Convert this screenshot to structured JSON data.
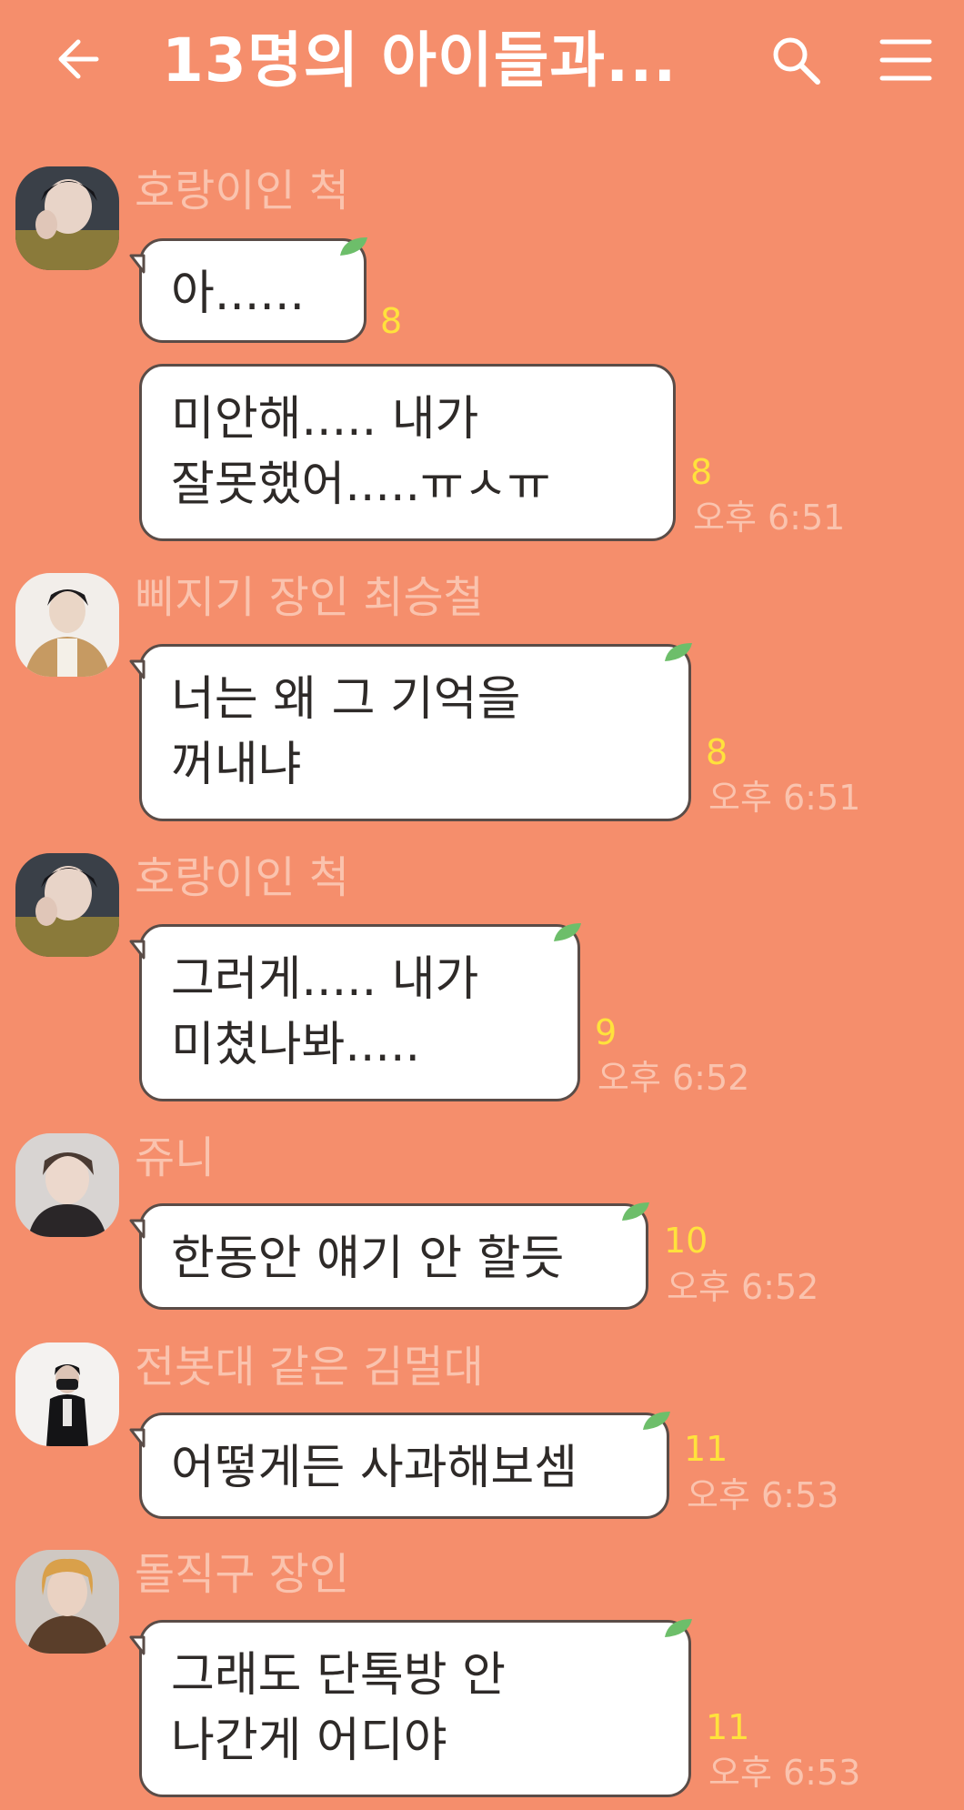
{
  "header": {
    "title": "13명의 아이들과...",
    "back_icon": "back-arrow-icon",
    "search_icon": "search-icon",
    "menu_icon": "hamburger-menu-icon",
    "background": "#F58E6C"
  },
  "messages": [
    {
      "sender": "호랑이인 척",
      "text_lines": [
        "아......"
      ],
      "unread": "8",
      "time": ""
    },
    {
      "sender": "",
      "text_lines": [
        "미안해..... 내가",
        "잘못했어.....ㅠㅅㅠ"
      ],
      "unread": "8",
      "time": "오후 6:51"
    },
    {
      "sender": "삐지기 장인 최승철",
      "text_lines": [
        "너는 왜 그 기억을",
        "꺼내냐"
      ],
      "unread": "8",
      "time": "오후 6:51"
    },
    {
      "sender": "호랑이인 척",
      "text_lines": [
        "그러게..... 내가",
        "미쳤나봐....."
      ],
      "unread": "9",
      "time": "오후 6:52"
    },
    {
      "sender": "쥬니",
      "text_lines": [
        "한동안 얘기 안 할듯"
      ],
      "unread": "10",
      "time": "오후 6:52"
    },
    {
      "sender": "전봇대 같은 김멀대",
      "text_lines": [
        "어떻게든 사과해보셈"
      ],
      "unread": "11",
      "time": "오후 6:53"
    },
    {
      "sender": "돌직구 장인",
      "text_lines": [
        "그래도 단톡방 안",
        "나간게 어디야"
      ],
      "unread": "11",
      "time": "오후 6:53"
    }
  ]
}
